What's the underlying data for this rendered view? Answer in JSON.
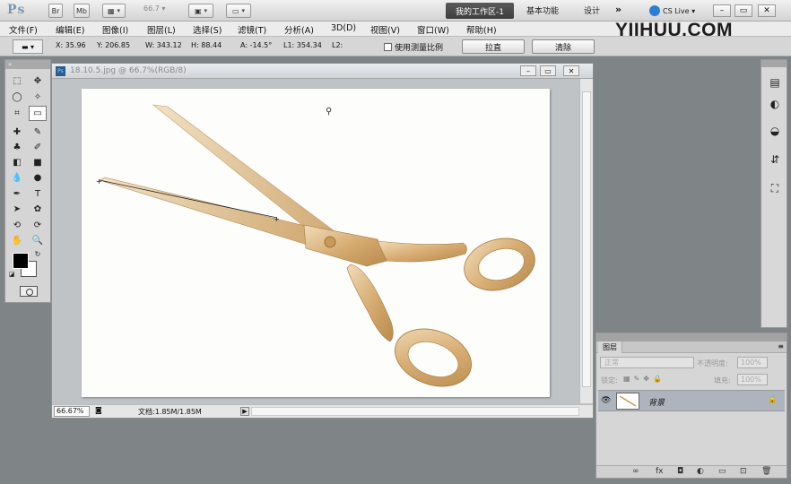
{
  "app": {
    "logo": "Ps",
    "zoom": "66.7",
    "bridge_btn": "Br",
    "minibridge_btn": "Mb",
    "active_workspace": "我的工作区-1",
    "workspaces": [
      "基本功能",
      "设计"
    ],
    "more": "»",
    "cs_live": "CS Live",
    "window_controls": [
      "–",
      "▭",
      "✕"
    ]
  },
  "watermark": "YIIHUU.COM",
  "menu": [
    "文件(F)",
    "编辑(E)",
    "图像(I)",
    "图层(L)",
    "选择(S)",
    "滤镜(T)",
    "分析(A)",
    "3D(D)",
    "视图(V)",
    "窗口(W)",
    "帮助(H)"
  ],
  "options": {
    "x": "X: 35.96",
    "y": "Y: 206.85",
    "w": "W: 343.12",
    "h": "H: 88.44",
    "a": "A: -14.5°",
    "l1": "L1: 354.34",
    "l2": "L2:",
    "measure_scale": "使用测量比例",
    "straighten": "拉直",
    "clear": "清除"
  },
  "document": {
    "title": "18.10.5.jpg @ 66.7%(RGB/8)",
    "zoom": "66.67%",
    "info": "文档:1.85M/1.85M",
    "controls": [
      "–",
      "▭",
      "✕"
    ]
  },
  "layers": {
    "tab": "图层",
    "blend_mode": "正常",
    "opacity_label": "不透明度:",
    "opacity": "100%",
    "lock_label": "锁定:",
    "fill_label": "填充:",
    "fill": "100%",
    "layer_name": "背景"
  },
  "colors": {
    "foreground": "#000000",
    "background": "#ffffff",
    "active_workspace_bg": "#4a4a4a",
    "layer_selected_bg": "#aeb4bd"
  }
}
